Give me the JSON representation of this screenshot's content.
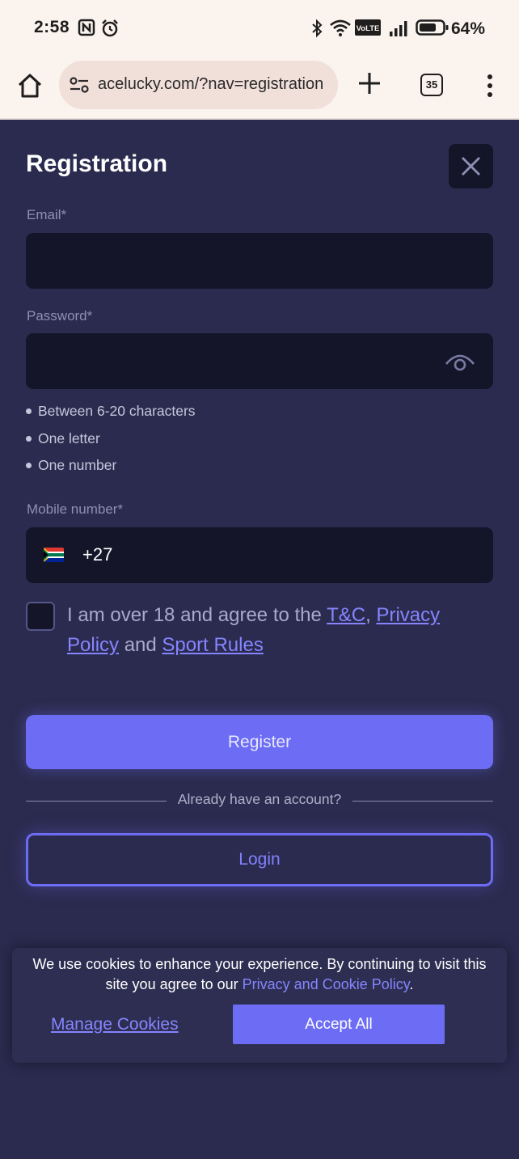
{
  "status_bar": {
    "time": "2:58",
    "battery_percent": "64%",
    "icons": [
      "nfc-icon",
      "alarm-icon",
      "bluetooth-icon",
      "wifi-icon",
      "volte-icon",
      "signal-icon",
      "battery-icon"
    ],
    "volte_label": "VoLTE"
  },
  "browser": {
    "url": "acelucky.com/?nav=registration",
    "tab_count": "35"
  },
  "registration": {
    "title": "Registration",
    "email_label": "Email*",
    "email_value": "",
    "password_label": "Password*",
    "password_value": "",
    "password_rules": [
      "Between 6-20 characters",
      "One letter",
      "One number"
    ],
    "mobile_label": "Mobile number*",
    "dial_code": "+27",
    "agree_prefix": "I am over 18 and agree to the ",
    "tc_link": "T&C",
    "comma": ", ",
    "privacy_link": "Privacy Policy",
    "and_text": " and ",
    "sport_rules_link": "Sport Rules",
    "register_button": "Register",
    "already_account": "Already have an account?",
    "login_button": "Login"
  },
  "cookie_banner": {
    "message": "We use cookies to enhance your experience. By continuing to visit this site you agree to our ",
    "policy_link": "Privacy and Cookie Policy",
    "period": ".",
    "manage_link": "Manage Cookies",
    "accept_button": "Accept All"
  },
  "colors": {
    "background": "#2b2b4f",
    "input_bg": "#15152a",
    "accent": "#6c6cf5",
    "link": "#8585ff"
  }
}
